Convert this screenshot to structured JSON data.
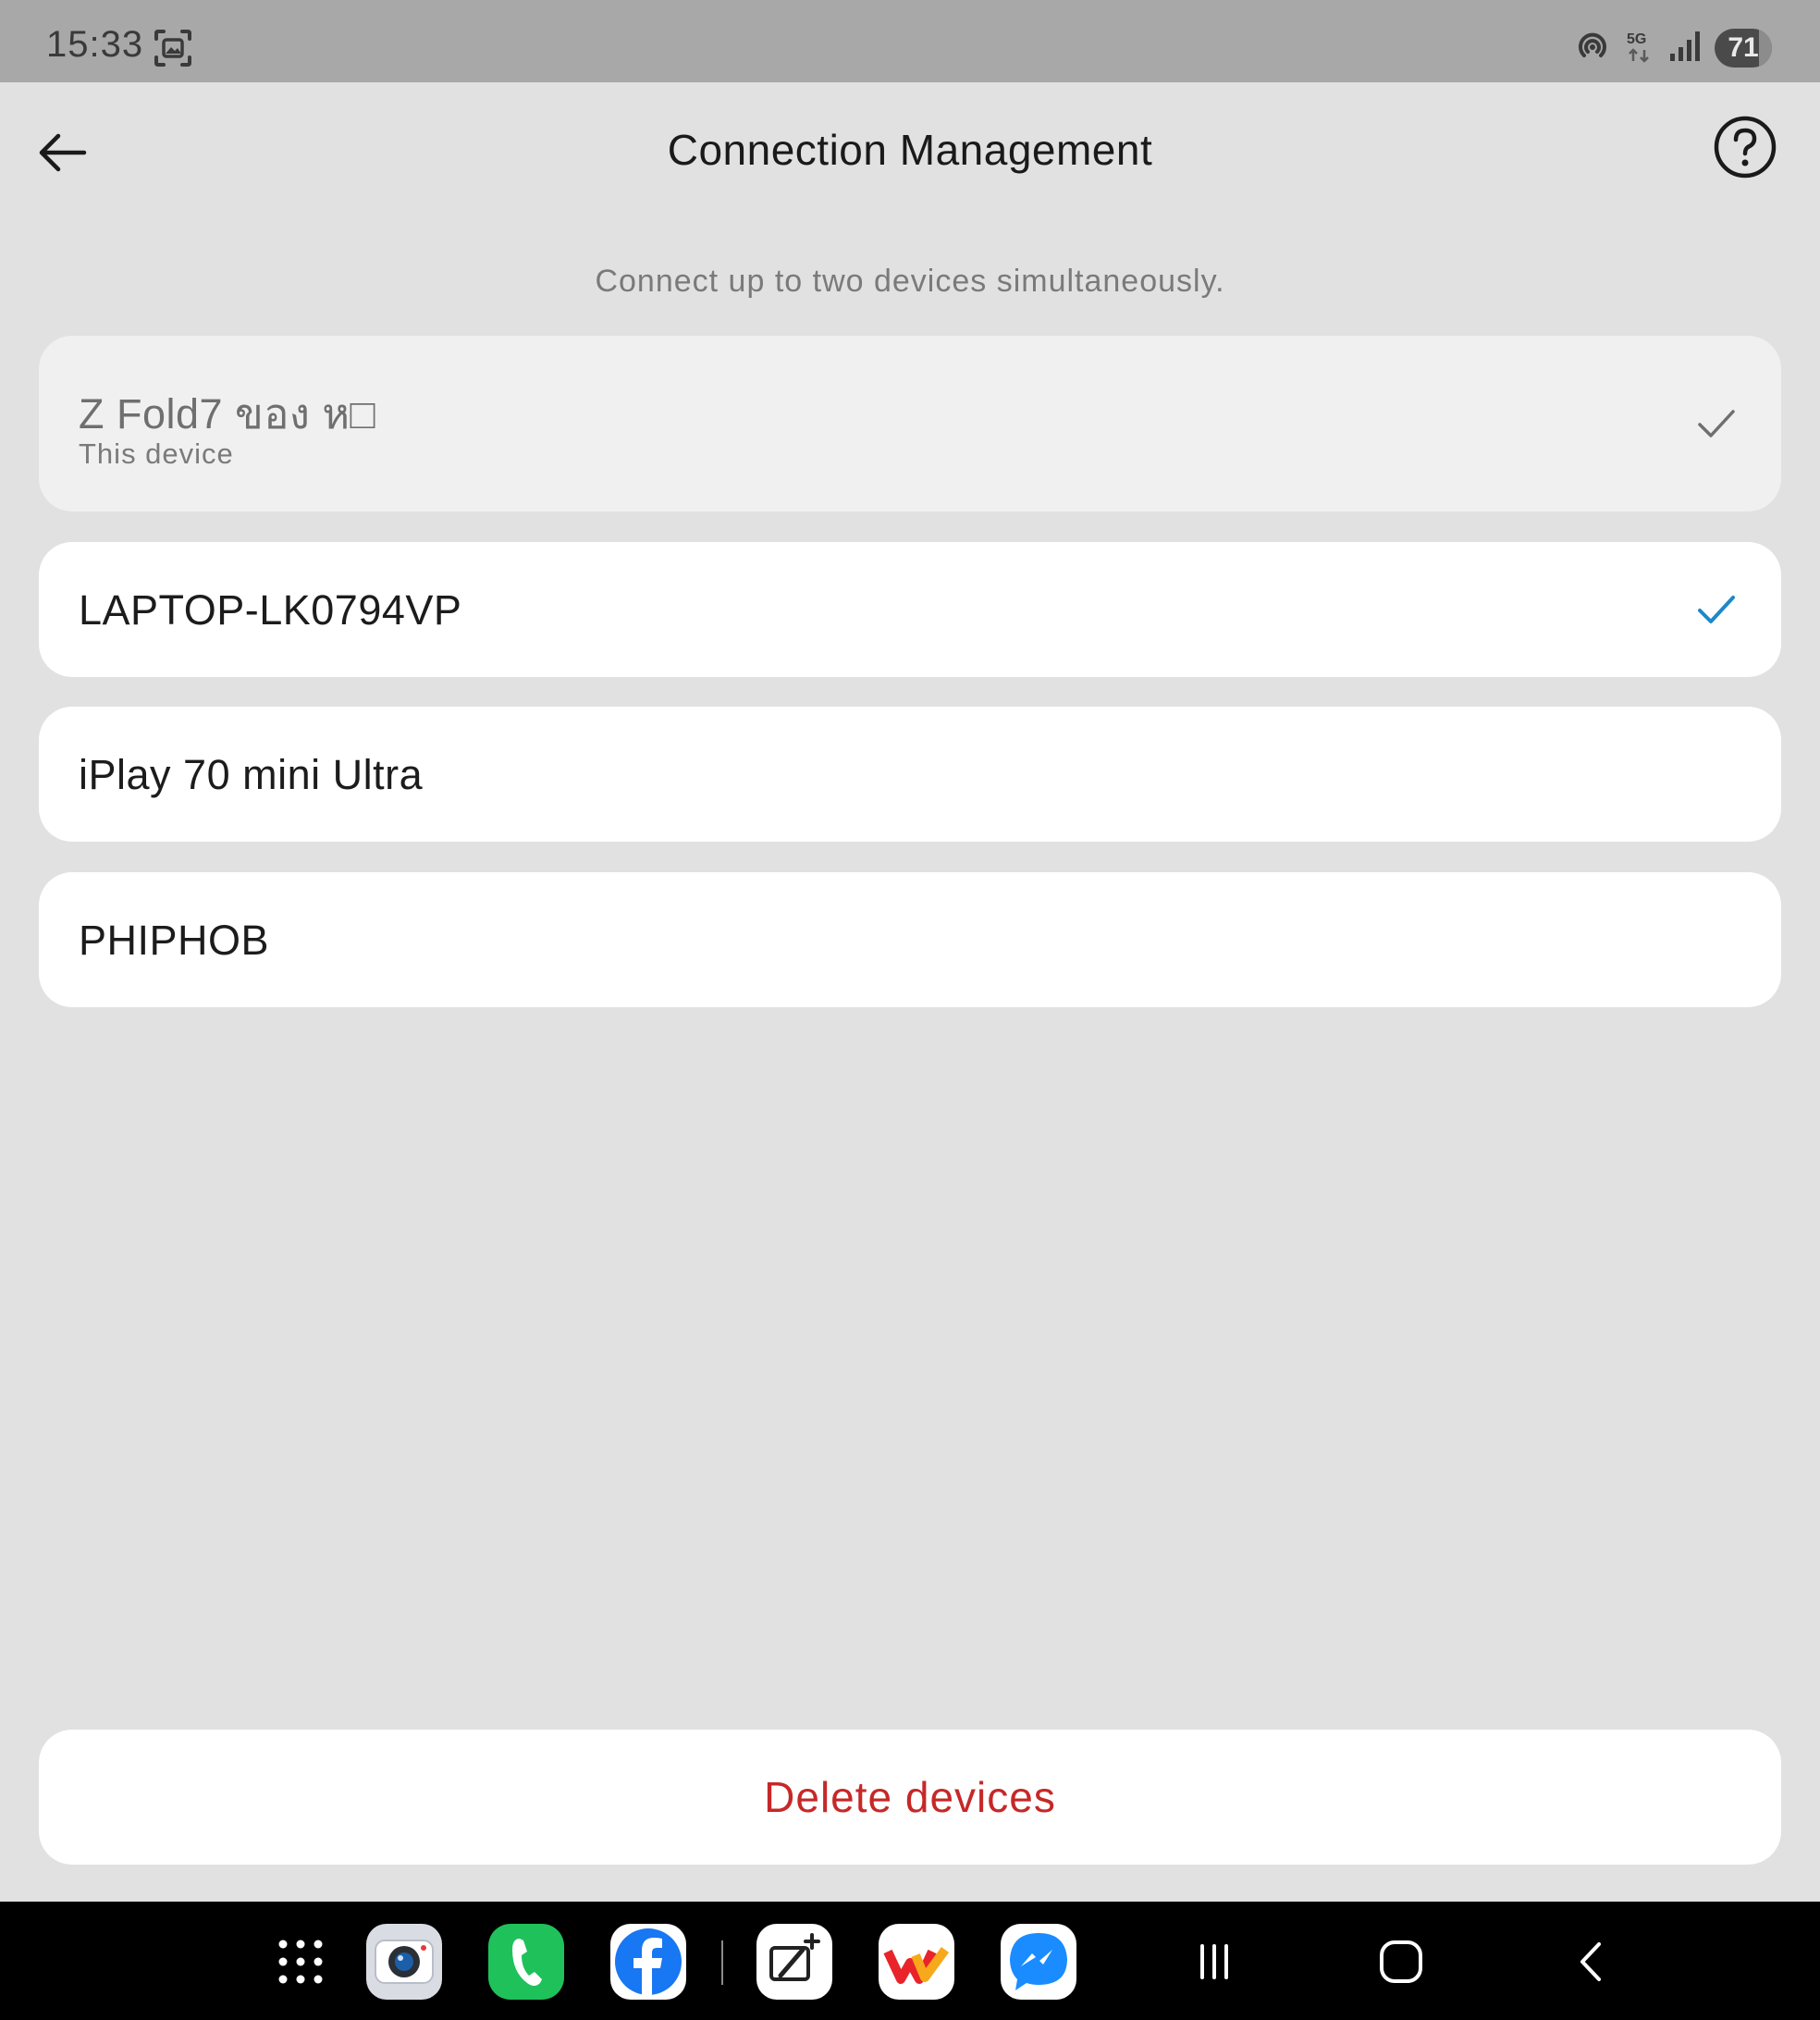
{
  "status_bar": {
    "time": "15:33",
    "battery": "71",
    "network": "5G",
    "icons": [
      "screenshot-icon",
      "hotspot-icon",
      "5g-icon",
      "signal-icon",
      "battery-icon"
    ]
  },
  "header": {
    "title": "Connection Management",
    "back_icon": "arrow-left-icon",
    "help_icon": "help-circle-icon"
  },
  "subtitle": "Connect up to two devices simultaneously.",
  "devices": [
    {
      "name": "Z Fold7 ของ ห□",
      "sub": "This device",
      "connected": true,
      "check_color": "#6f6f6f"
    },
    {
      "name": "LAPTOP-LK0794VP",
      "connected": true,
      "check_color": "#1e88c8"
    },
    {
      "name": "iPlay 70 mini Ultra",
      "connected": false
    },
    {
      "name": "PHIPHOB",
      "connected": false
    }
  ],
  "delete_label": "Delete devices",
  "colors": {
    "accent_check": "#1e88c8",
    "delete_text": "#c62828",
    "background": "#e1e1e1"
  },
  "taskbar": {
    "apps": [
      "app-drawer-icon",
      "camera-app-icon",
      "phone-app-icon",
      "facebook-app-icon",
      "pen-note-app-icon",
      "shopping-app-icon",
      "messenger-app-icon"
    ],
    "nav": [
      "recents-icon",
      "home-icon",
      "back-icon"
    ]
  }
}
